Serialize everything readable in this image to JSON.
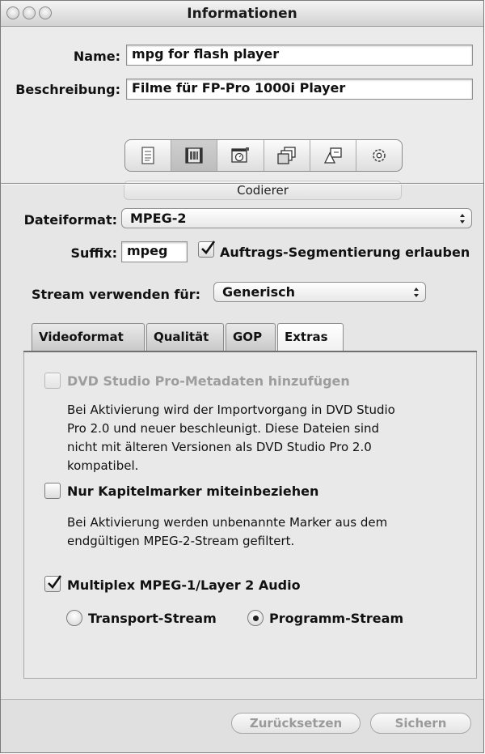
{
  "window": {
    "title": "Informationen"
  },
  "name_label": "Name:",
  "name_value": "mpg for flash player",
  "desc_label": "Beschreibung:",
  "desc_value": "Filme für FP-Pro 1000i Player",
  "toolbar_icons": [
    "summary-icon",
    "encoder-icon",
    "frame-controls-icon",
    "filters-icon",
    "geometry-icon",
    "actions-icon"
  ],
  "panel_title": "Codierer",
  "format_label": "Dateiformat:",
  "format_value": "MPEG-2",
  "suffix_label": "Suffix:",
  "suffix_value": "mpeg",
  "segmentation_label": "Auftrags-Segmentierung erlauben",
  "segmentation_checked": true,
  "stream_use_label": "Stream verwenden für:",
  "stream_use_value": "Generisch",
  "tabs": [
    {
      "label": "Videoformat"
    },
    {
      "label": "Qualität"
    },
    {
      "label": "GOP"
    },
    {
      "label": "Extras"
    }
  ],
  "active_tab": "Extras",
  "extras": {
    "dvd_metadata_label": "DVD Studio Pro-Metadaten hinzufügen",
    "dvd_metadata_desc_1": "Bei Aktivierung wird der Importvorgang in DVD Studio",
    "dvd_metadata_desc_2": "Pro 2.0 und neuer beschleunigt. Diese Dateien sind",
    "dvd_metadata_desc_3": "nicht mit älteren Versionen als DVD Studio Pro 2.0",
    "dvd_metadata_desc_4": "kompatibel.",
    "chapter_label": "Nur Kapitelmarker miteinbeziehen",
    "chapter_desc_1": "Bei Aktivierung werden unbenannte Marker aus dem",
    "chapter_desc_2": "endgültigen MPEG-2-Stream gefiltert.",
    "multiplex_label": "Multiplex MPEG-1/Layer 2 Audio",
    "multiplex_checked": true,
    "transport_label": "Transport-Stream",
    "program_label": "Programm-Stream",
    "selected_stream": "Programm-Stream"
  },
  "reset_button": "Zurücksetzen",
  "save_button": "Sichern"
}
